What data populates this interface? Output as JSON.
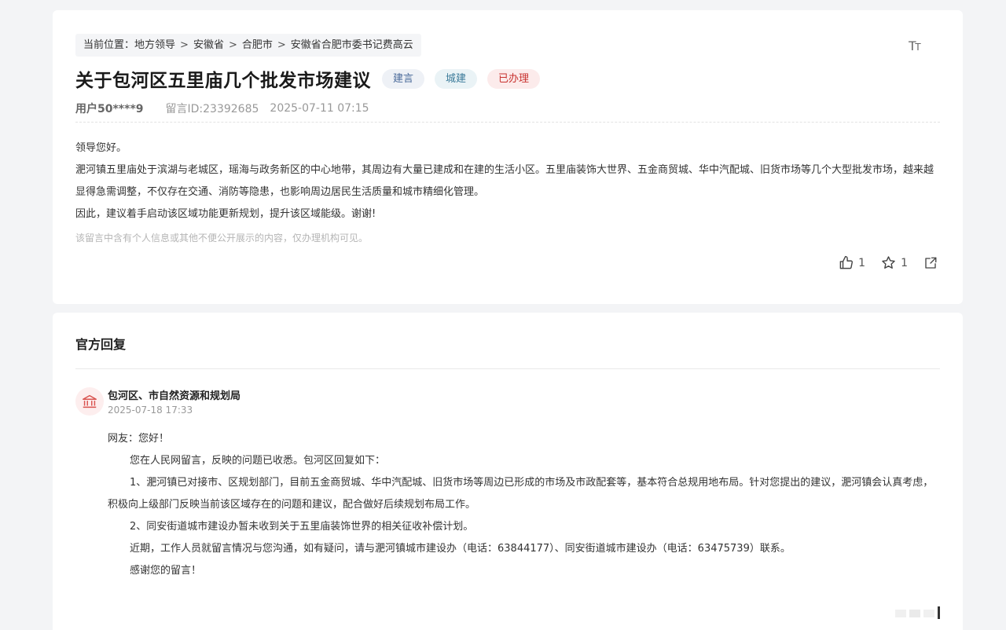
{
  "breadcrumb": {
    "prefix": "当前位置：",
    "items": [
      "地方领导",
      "安徽省",
      "合肥市",
      "安徽省合肥市委书记费高云"
    ],
    "separator": ">"
  },
  "font_toggle": {
    "icon": "font-size-icon"
  },
  "message": {
    "title": "关于包河区五里庙几个批发市场建议",
    "tags": {
      "type": "建言",
      "domain": "城建",
      "status": "已办理"
    },
    "user": "用户50****9",
    "message_id": "留言ID:23392685",
    "datetime": "2025-07-11 07:15",
    "paragraphs": [
      "领导您好。",
      "淝河镇五里庙处于滨湖与老城区，瑶海与政务新区的中心地带，其周边有大量已建成和在建的生活小区。五里庙装饰大世界、五金商贸城、华中汽配城、旧货市场等几个大型批发市场，越来越显得急需调整，不仅存在交通、消防等隐患，也影响周边居民生活质量和城市精细化管理。",
      "因此，建议着手启动该区域功能更新规划，提升该区域能级。谢谢!"
    ],
    "privacy_note": "该留言中含有个人信息或其他不便公开展示的内容，仅办理机构可见。",
    "likes": "1",
    "favorites": "1"
  },
  "reply": {
    "section_title": "官方回复",
    "department": "包河区、市自然资源和规划局",
    "datetime": "2025-07-18 17:33",
    "greeting": "网友：您好！",
    "paragraphs": [
      "您在人民网留言，反映的问题已收悉。包河区回复如下：",
      "1、淝河镇已对接市、区规划部门，目前五金商贸城、华中汽配城、旧货市场等周边已形成的市场及市政配套等，基本符合总规用地布局。针对您提出的建议，淝河镇会认真考虑，积极向上级部门反映当前该区域存在的问题和建议，配合做好后续规划布局工作。",
      "2、同安街道城市建设办暂未收到关于五里庙装饰世界的相关征收补偿计划。",
      "近期，工作人员就留言情况与您沟通，如有疑问，请与淝河镇城市建设办（电话：63844177）、同安街道城市建设办（电话：63475739）联系。",
      "感谢您的留言！"
    ]
  },
  "colors": {
    "page_bg": "#f3f4f6",
    "card_bg": "#ffffff",
    "status_red": "#c8322f",
    "tag_blue": "#4a6a9a"
  }
}
